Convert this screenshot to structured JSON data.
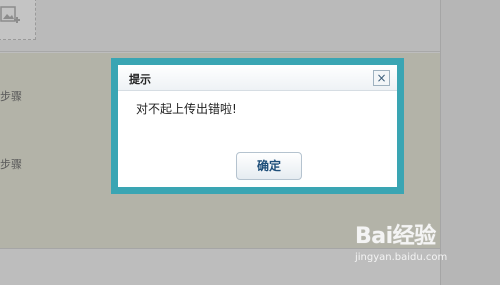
{
  "background": {
    "step_labels": [
      "步骤",
      "步骤"
    ]
  },
  "dialog": {
    "title": "提示",
    "close_glyph": "×",
    "message": "对不起上传出错啦!",
    "ok_label": "确定"
  },
  "watermark": {
    "logo_text": "Bai经验",
    "url_text": "jingyan.baidu.com"
  },
  "colors": {
    "dialog_border": "#3aa5b3",
    "overlay_bg": "#bdbdbd",
    "button_text": "#1f4f7a"
  }
}
